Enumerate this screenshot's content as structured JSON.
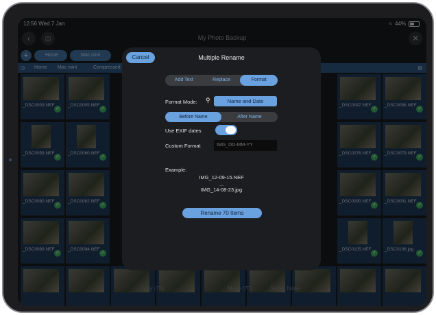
{
  "status": {
    "time": "12:56",
    "date": "Wed 7 Jan",
    "battery": "44%"
  },
  "nav": {
    "title": "My Photo Backup"
  },
  "tabs": [
    {
      "label": "Home"
    },
    {
      "label": "Mac mini"
    }
  ],
  "breadcrumb": [
    "Home",
    "Mac mini",
    "Compressed"
  ],
  "grid_files": [
    "_DSC0003.NEF",
    "_DSC0005.NEF",
    "_DSC0047.NEF",
    "_DSC0056.NEF",
    "_DSC0059.NEF",
    "_DSC0060.NEF",
    "_DSC0076.NEF",
    "_DSC0079.NEF",
    "_DSC0080.NEF",
    "_DSC0082.NEF",
    "_DSC0090.NEF",
    "_DSC0091.NEF",
    "_DSC0093.NEF",
    "_DSC0094.NEF",
    "_DSC0105.NEF",
    "_DSC0106.jpg"
  ],
  "bottom": {
    "copy": "Copy (70)",
    "move": "Move (70)",
    "select_none": "Select None"
  },
  "modal": {
    "title": "Multiple Rename",
    "cancel": "Cancel",
    "tabs": [
      {
        "label": "Add Text"
      },
      {
        "label": "Replace"
      },
      {
        "label": "Format"
      }
    ],
    "format_mode_label": "Format Mode:",
    "format_mode_value": "Name and Date",
    "position": [
      {
        "label": "Before Name"
      },
      {
        "label": "After Name"
      }
    ],
    "exif_label": "Use EXIF dates",
    "exif_on": true,
    "custom_format_label": "Custom Format",
    "custom_format_placeholder": "IMG_DD-MM-YY",
    "example_label": "Example:",
    "example_1": "IMG_12-09-15.NEF",
    "example_sep": "...",
    "example_2": "IMG_14-08-23.jpg",
    "rename_button": "Rename 70 Items"
  },
  "colors": {
    "accent": "#6aa2e0",
    "check": "#3aa05a",
    "modal_bg": "#1c1d20"
  }
}
